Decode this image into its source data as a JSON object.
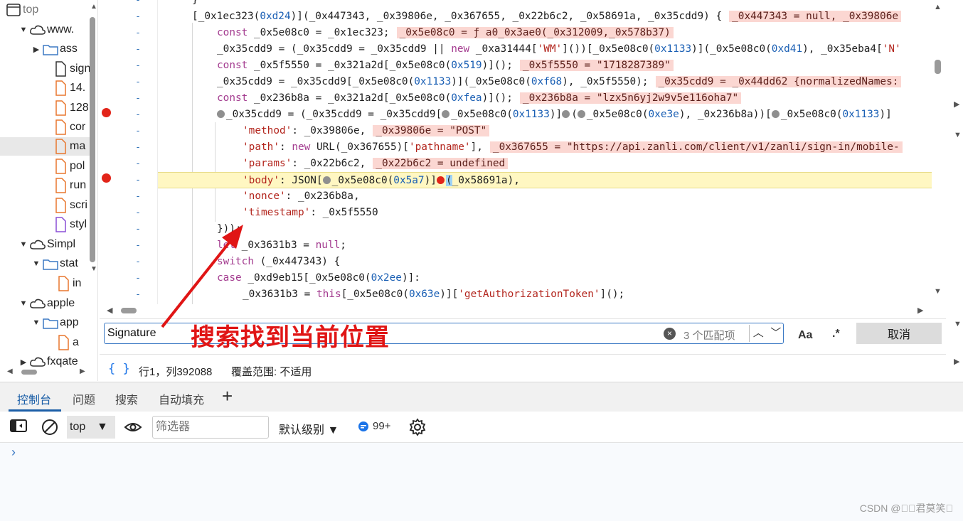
{
  "tree": {
    "items": [
      {
        "label": "top",
        "twisty": "",
        "icon": "window-icon"
      },
      {
        "label": "www.",
        "twisty": "▼",
        "icon": "cloud-icon"
      },
      {
        "label": "ass",
        "twisty": "▶",
        "icon": "folder-icon"
      },
      {
        "label": "sign",
        "twisty": "",
        "icon": "file-icon"
      },
      {
        "label": "14.",
        "twisty": "",
        "icon": "file-icon"
      },
      {
        "label": "128",
        "twisty": "",
        "icon": "file-icon"
      },
      {
        "label": "cor",
        "twisty": "",
        "icon": "file-icon"
      },
      {
        "label": "ma",
        "twisty": "",
        "icon": "file-icon"
      },
      {
        "label": "pol",
        "twisty": "",
        "icon": "file-icon"
      },
      {
        "label": "run",
        "twisty": "",
        "icon": "file-icon"
      },
      {
        "label": "scri",
        "twisty": "",
        "icon": "file-icon"
      },
      {
        "label": "styl",
        "twisty": "",
        "icon": "file-icon"
      },
      {
        "label": "Simpl",
        "twisty": "▼",
        "icon": "cloud-icon"
      },
      {
        "label": "stat",
        "twisty": "▼",
        "icon": "folder-icon"
      },
      {
        "label": "in",
        "twisty": "",
        "icon": "file-icon"
      },
      {
        "label": "apple",
        "twisty": "▼",
        "icon": "cloud-icon"
      },
      {
        "label": "app",
        "twisty": "▼",
        "icon": "folder-icon"
      },
      {
        "label": "a",
        "twisty": "",
        "icon": "file-icon"
      },
      {
        "label": "fxqate",
        "twisty": "▶",
        "icon": "cloud-icon"
      }
    ]
  },
  "code": {
    "line_marker": "-",
    "lines": [
      {
        "text": "}"
      },
      {
        "text": "[_0x1ec323(0xd24)](_0x447343, _0x39806e, _0x367655, _0x2b6c2, _0x58691a, _0x35cdd9) {",
        "eval": "_0x447343 = null, _0x39806e"
      },
      {
        "text": "const _0x5e08c0 = _0x1ec323;",
        "eval": "_0x5e08c0 = ƒ a0_0x3ae0(_0x312009,_0x578b37)"
      },
      {
        "text": "_0x35cdd9 = (_0x35cdd9 = _0x35cdd9 || new _0xa31444['WM']())[_0x5e08c0(0x1133)](_0x5e08c0(0xd41), _0x35eba4['N'"
      },
      {
        "text": "const _0x5f5550 = _0x321a2d[_0x5e08c0(0x519)]();",
        "eval": "_0x5f5550 = \"1718287389\""
      },
      {
        "text": "_0x35cdd9 = _0x35cdd9[_0x5e08c0(0x1133)](_0x5e08c0(0xf68), _0x5f5550);",
        "eval": "_0x35cdd9 = _0x44dd62 {normalizedNames:"
      },
      {
        "text": "const _0x236b8a = _0x321a2d[_0x5e08c0(0xfea)]();",
        "eval": "_0x236b8a = \"lzx5n6yj2w9v5e116oha7\""
      },
      {
        "text": "_0x35cdd9 = (_0x35cdd9 = _0x35cdd9[_0x5e08c0(0x1133)](_0x5e08c0(0xe3e), _0x236b8a))[_0x5e08c0(0x1133)]"
      },
      {
        "text": "'method': _0x39806e,",
        "eval": "_0x39806e = \"POST\""
      },
      {
        "text": "'path': new URL(_0x367655)['pathname'],",
        "eval": "_0x367655 = \"https://api.zanli.com/client/v1/zanli/sign-in/mobile-"
      },
      {
        "text": "'params': _0x22b6c2,",
        "eval": "_0x22b6c2 = undefined"
      },
      {
        "text": "'body': JSON[_0x5e08c0(0x5a7)](_0x58691a),"
      },
      {
        "text": "'nonce': _0x236b8a,"
      },
      {
        "text": "'timestamp': _0x5f5550"
      },
      {
        "text": "}));"
      },
      {
        "text": "let _0x3631b3 = null;"
      },
      {
        "text": "switch (_0x447343) {"
      },
      {
        "text": "case _0xd9eb15[_0x5e08c0(0x2ee)]:"
      },
      {
        "text": "_0x3631b3 = this[_0x5e08c0(0x63e)]['getAuthorizationToken']();"
      }
    ]
  },
  "search": {
    "value": "Signature",
    "match_count": "3 个匹配项",
    "case_label": "Aa",
    "regex_label": ".*",
    "cancel_label": "取消"
  },
  "annotation": {
    "text": "搜索找到当前位置",
    "color": "#e01515"
  },
  "status": {
    "braces": "{ }",
    "position": "行1，列392088",
    "coverage": "覆盖范围: 不适用"
  },
  "drawer": {
    "tabs": [
      "控制台",
      "问题",
      "搜索",
      "自动填充"
    ],
    "active_tab": "控制台",
    "add_tab": "+"
  },
  "console": {
    "context": "top",
    "filter_placeholder": "筛选器",
    "level": "默认级别",
    "message_count": "99+",
    "prompt": "›"
  },
  "watermark": "CSDN @\u0000\u0000君莫笑\u0000",
  "colors": {
    "accent": "#1b5ea7",
    "breakpoint": "#e22419",
    "highlight_line": "#fff7c2",
    "eval_bg": "#fbd7d2"
  }
}
